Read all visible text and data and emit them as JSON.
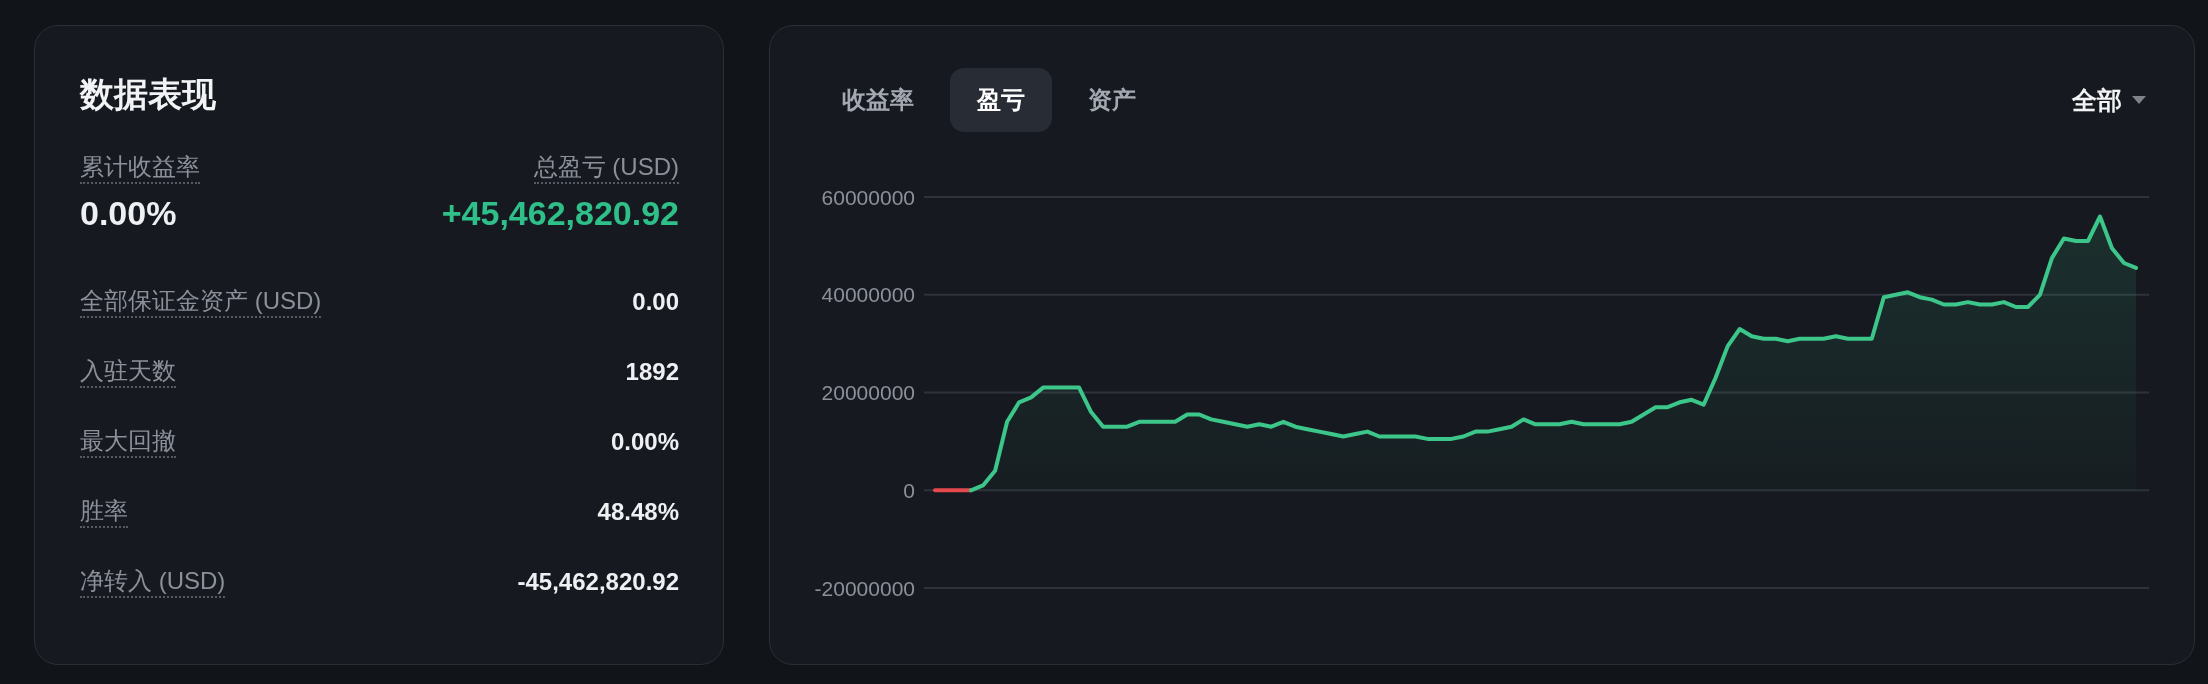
{
  "performance": {
    "title": "数据表现",
    "summary": [
      {
        "label": "累计收益率",
        "value": "0.00%",
        "color": "#eef0f3"
      },
      {
        "label": "总盈亏 (USD)",
        "value": "+45,462,820.92",
        "color": "#2fc08a"
      }
    ],
    "rows": [
      {
        "label": "全部保证金资产 (USD)",
        "value": "0.00"
      },
      {
        "label": "入驻天数",
        "value": "1892"
      },
      {
        "label": "最大回撤",
        "value": "0.00%"
      },
      {
        "label": "胜率",
        "value": "48.48%"
      },
      {
        "label": "净转入 (USD)",
        "value": "-45,462,820.92"
      }
    ]
  },
  "chart_panel": {
    "tabs": [
      {
        "label": "收益率",
        "selected": false
      },
      {
        "label": "盈亏",
        "selected": true
      },
      {
        "label": "资产",
        "selected": false
      }
    ],
    "range_dropdown": {
      "value": "全部"
    },
    "chart_data": {
      "type": "area",
      "grid": true,
      "ylim": [
        -20000000,
        60000000
      ],
      "yticks": [
        -20000000,
        0,
        20000000,
        40000000,
        60000000
      ],
      "series": [
        {
          "type": "line",
          "color": "#e5484d",
          "values": [
            0,
            0,
            0,
            0,
            null,
            null,
            null,
            null,
            null,
            null,
            null,
            null,
            null,
            null,
            null,
            null,
            null,
            null,
            null,
            null,
            null,
            null,
            null,
            null,
            null,
            null,
            null,
            null,
            null,
            null,
            null,
            null,
            null,
            null,
            null,
            null,
            null,
            null,
            null,
            null,
            null,
            null,
            null,
            null,
            null,
            null,
            null,
            null,
            null,
            null,
            null,
            null,
            null,
            null,
            null,
            null,
            null,
            null,
            null,
            null,
            null,
            null,
            null,
            null,
            null,
            null,
            null,
            null,
            null,
            null,
            null,
            null,
            null,
            null,
            null,
            null,
            null,
            null,
            null,
            null,
            null,
            null,
            null,
            null,
            null,
            null,
            null,
            null,
            null,
            null,
            null,
            null,
            null,
            null,
            null,
            null,
            null,
            null,
            null,
            null,
            null
          ]
        },
        {
          "color": "#3cc68a",
          "values": [
            null,
            null,
            null,
            0,
            1000000,
            4000000,
            14000000,
            18000000,
            19000000,
            21000000,
            21000000,
            21000000,
            21000000,
            16000000,
            13000000,
            13000000,
            13000000,
            14000000,
            14000000,
            14000000,
            14000000,
            15500000,
            15500000,
            14500000,
            14000000,
            13500000,
            13000000,
            13500000,
            13000000,
            14000000,
            13000000,
            12500000,
            12000000,
            11500000,
            11000000,
            11500000,
            12000000,
            11000000,
            11000000,
            11000000,
            11000000,
            10500000,
            10500000,
            10500000,
            11000000,
            12000000,
            12000000,
            12500000,
            13000000,
            14500000,
            13500000,
            13500000,
            13500000,
            14000000,
            13500000,
            13500000,
            13500000,
            13500000,
            14000000,
            15500000,
            17000000,
            17000000,
            18000000,
            18500000,
            17500000,
            23000000,
            29500000,
            33000000,
            31500000,
            31000000,
            31000000,
            30500000,
            31000000,
            31000000,
            31000000,
            31500000,
            31000000,
            31000000,
            31000000,
            39500000,
            40000000,
            40500000,
            39500000,
            39000000,
            38000000,
            38000000,
            38500000,
            38000000,
            38000000,
            38500000,
            37500000,
            37500000,
            40000000,
            47500000,
            51500000,
            51000000,
            51000000,
            56000000,
            49500000,
            46500000,
            45500000
          ]
        }
      ]
    }
  }
}
